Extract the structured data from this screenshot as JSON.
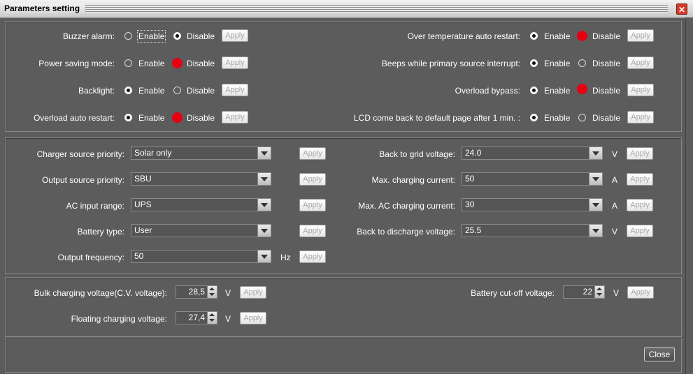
{
  "window": {
    "title": "Parameters setting",
    "close_glyph": "✕"
  },
  "common": {
    "enable": "Enable",
    "disable": "Disable",
    "apply": "Apply"
  },
  "toggles_left": [
    {
      "label": "Buzzer alarm:",
      "selected": "disable",
      "marker": false
    },
    {
      "label": "Power saving mode:",
      "selected": "none",
      "marker": true
    },
    {
      "label": "Backlight:",
      "selected": "enable",
      "marker": false
    },
    {
      "label": "Overload auto restart:",
      "selected": "enable",
      "marker": true
    }
  ],
  "toggles_right": [
    {
      "label": "Over temperature auto restart:",
      "selected": "enable",
      "marker": true
    },
    {
      "label": "Beeps while primary source interrupt:",
      "selected": "enable",
      "marker": false
    },
    {
      "label": "Overload bypass:",
      "selected": "enable",
      "marker": true
    },
    {
      "label": "LCD come back to default page after 1 min. :",
      "selected": "enable",
      "marker": false
    }
  ],
  "selects_left": [
    {
      "label": "Charger source priority:",
      "value": "Solar only",
      "unit": ""
    },
    {
      "label": "Output source priority:",
      "value": "SBU",
      "unit": ""
    },
    {
      "label": "AC input range:",
      "value": "UPS",
      "unit": ""
    },
    {
      "label": "Battery type:",
      "value": "User",
      "unit": ""
    },
    {
      "label": "Output frequency:",
      "value": "50",
      "unit": "Hz"
    }
  ],
  "selects_right": [
    {
      "label": "Back to grid voltage:",
      "value": "24.0",
      "unit": "V"
    },
    {
      "label": "Max. charging current:",
      "value": "50",
      "unit": "A"
    },
    {
      "label": "Max. AC charging current:",
      "value": "30",
      "unit": "A"
    },
    {
      "label": "Back to discharge voltage:",
      "value": "25.5",
      "unit": "V"
    }
  ],
  "spinners": {
    "bulk": {
      "label": "Bulk charging voltage(C.V. voltage):",
      "value": "28,5",
      "unit": "V"
    },
    "floating": {
      "label": "Floating charging voltage:",
      "value": "27,4",
      "unit": "V"
    },
    "cutoff": {
      "label": "Battery cut-off voltage:",
      "value": "22",
      "unit": "V"
    }
  },
  "footer": {
    "close_label": "Close"
  },
  "colors": {
    "marker": "#e60012",
    "background": "#5c5c5c",
    "close_x": "#d43a2a"
  }
}
